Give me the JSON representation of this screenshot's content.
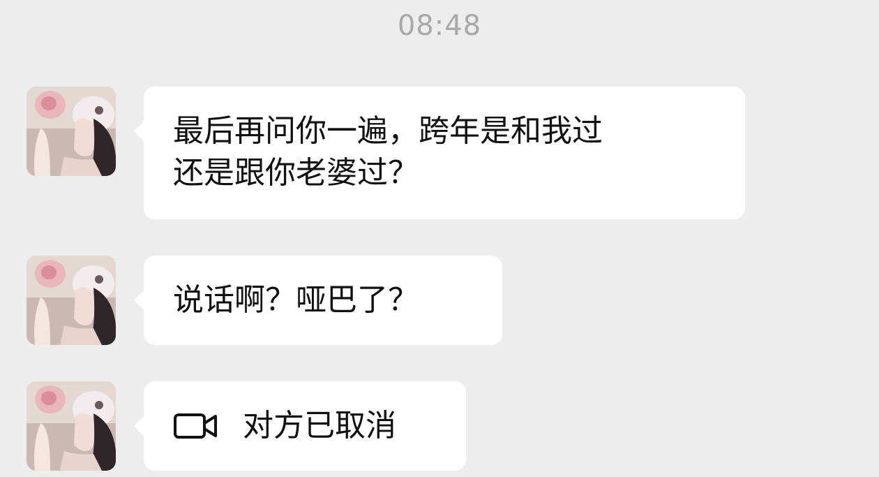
{
  "timestamp": "08:48",
  "messages": [
    {
      "lines": [
        "最后再问你一遍，跨年是和我过",
        "还是跟你老婆过？"
      ]
    },
    {
      "lines": [
        "说话啊？哑巴了？"
      ]
    },
    {
      "icon": "video-camera-icon",
      "text": "对方已取消"
    }
  ],
  "colors": {
    "background": "#ededed",
    "bubble": "#ffffff",
    "timestamp": "#a8a8a8",
    "text": "#111111"
  }
}
